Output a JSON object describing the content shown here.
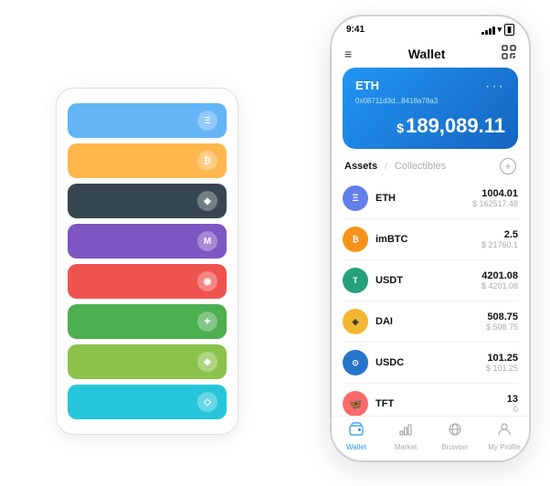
{
  "scene": {
    "background": "#ffffff"
  },
  "card_stack": {
    "cards": [
      {
        "color_class": "card-blue",
        "icon": "Ξ",
        "id": "eth-stack"
      },
      {
        "color_class": "card-orange",
        "icon": "₿",
        "id": "btc-stack"
      },
      {
        "color_class": "card-dark",
        "icon": "◆",
        "id": "dark-stack"
      },
      {
        "color_class": "card-purple",
        "icon": "M",
        "id": "purple-stack"
      },
      {
        "color_class": "card-red",
        "icon": "◉",
        "id": "red-stack"
      },
      {
        "color_class": "card-green",
        "icon": "✦",
        "id": "green-stack"
      },
      {
        "color_class": "card-light-green",
        "icon": "◈",
        "id": "lgreen-stack"
      },
      {
        "color_class": "card-teal",
        "icon": "◇",
        "id": "teal-stack"
      }
    ]
  },
  "phone": {
    "status_bar": {
      "time": "9:41",
      "wifi": true,
      "battery": true
    },
    "header": {
      "title": "Wallet",
      "menu_icon": "≡",
      "scan_icon": "⛶"
    },
    "balance_card": {
      "coin": "ETH",
      "address": "0x08711d3d...8418a78a3",
      "lock_icon": "🔒",
      "amount": "189,089.11",
      "currency_symbol": "$",
      "more_icon": "···"
    },
    "assets_section": {
      "tab_active": "Assets",
      "tab_divider": "/",
      "tab_inactive": "Collectibles",
      "add_icon": "+"
    },
    "assets": [
      {
        "symbol": "ETH",
        "icon_text": "Ξ",
        "icon_class": "eth-icon",
        "amount": "1004.01",
        "usd_value": "$ 162517.48"
      },
      {
        "symbol": "imBTC",
        "icon_text": "₿",
        "icon_class": "imbtc-icon",
        "amount": "2.5",
        "usd_value": "$ 21760.1"
      },
      {
        "symbol": "USDT",
        "icon_text": "T",
        "icon_class": "usdt-icon",
        "amount": "4201.08",
        "usd_value": "$ 4201.08"
      },
      {
        "symbol": "DAI",
        "icon_text": "◈",
        "icon_class": "dai-icon",
        "amount": "508.75",
        "usd_value": "$ 508.75"
      },
      {
        "symbol": "USDC",
        "icon_text": "⊙",
        "icon_class": "usdc-icon",
        "amount": "101.25",
        "usd_value": "$ 101.25"
      },
      {
        "symbol": "TFT",
        "icon_text": "🦋",
        "icon_class": "tft-icon",
        "amount": "13",
        "usd_value": "0"
      }
    ],
    "nav": [
      {
        "label": "Wallet",
        "icon": "◉",
        "active": true
      },
      {
        "label": "Market",
        "icon": "📊",
        "active": false
      },
      {
        "label": "Browser",
        "icon": "👤",
        "active": false
      },
      {
        "label": "My Profile",
        "icon": "👤",
        "active": false
      }
    ]
  }
}
